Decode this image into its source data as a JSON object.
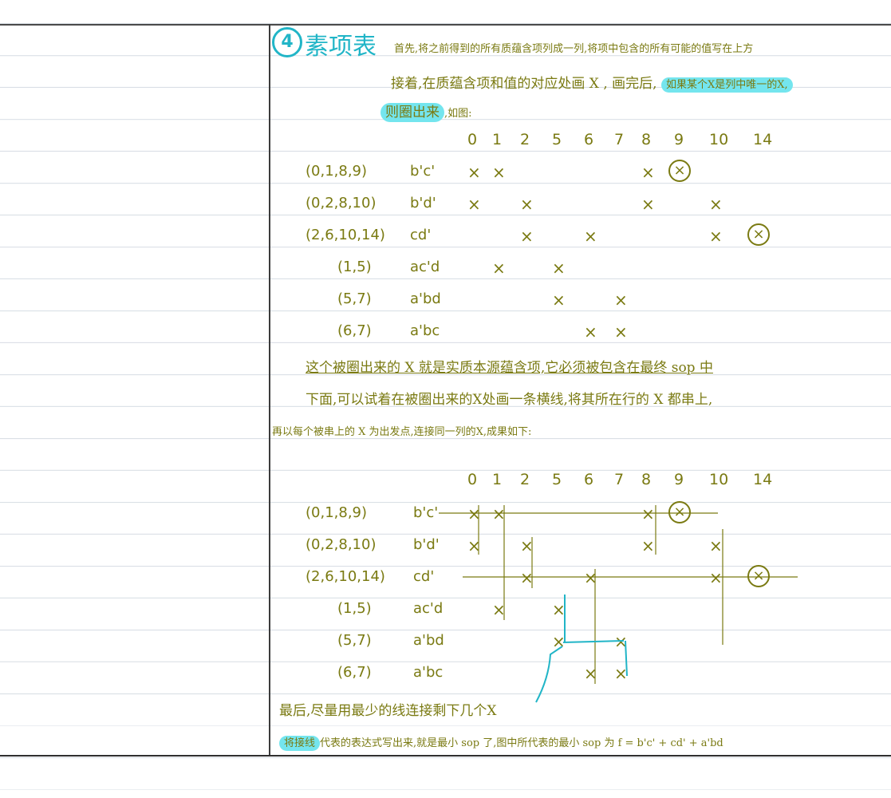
{
  "title": {
    "number": "4",
    "text": "素项表"
  },
  "paragraphs": {
    "p1": "首先,将之前得到的所有质蕴含项列成一列,将项中包含的所有可能的值写在上方",
    "p2_a": "接着,在质蕴含项和值的对应处画 X , 画完后,",
    "p2_b": "如果某个X是列中唯一的X,",
    "p3_hl": "则圈出来",
    "p3_rest": ",如图:",
    "p4": "这个被圈出来的 X 就是实质本源蕴含项,它必须被包含在最终 sop 中",
    "p5": "下面,可以试着在被圈出来的X处画一条横线,将其所在行的 X 都串上,",
    "p6": "再以每个被串上的 X 为出发点,连接同一列的X,成果如下:",
    "p7": "最后,尽量用最少的线连接剩下几个X",
    "p8_hl": "将接线",
    "p8_rest": "代表的表达式写出来,就是最小 sop 了,图中所代表的最小 sop 为 f = b'c' + cd' + a'bd"
  },
  "table1": {
    "columns": [
      "0",
      "1",
      "2",
      "5",
      "6",
      "7",
      "8",
      "9",
      "10",
      "14"
    ],
    "rows": [
      {
        "group": "(0,1,8,9)",
        "term": "b'c'",
        "marks": [
          "0",
          "1",
          "8"
        ],
        "circled": [
          "9"
        ]
      },
      {
        "group": "(0,2,8,10)",
        "term": "b'd'",
        "marks": [
          "0",
          "2",
          "8",
          "10"
        ],
        "circled": []
      },
      {
        "group": "(2,6,10,14)",
        "term": "cd'",
        "marks": [
          "2",
          "6",
          "10"
        ],
        "circled": [
          "14"
        ]
      },
      {
        "group": "(1,5)",
        "term": "ac'd",
        "marks": [
          "1",
          "5"
        ],
        "circled": []
      },
      {
        "group": "(5,7)",
        "term": "a'bd",
        "marks": [
          "5",
          "7"
        ],
        "circled": []
      },
      {
        "group": "(6,7)",
        "term": "a'bc",
        "marks": [
          "6",
          "7"
        ],
        "circled": []
      }
    ]
  },
  "table2": {
    "columns": [
      "0",
      "1",
      "2",
      "5",
      "6",
      "7",
      "8",
      "9",
      "10",
      "14"
    ],
    "rows": [
      {
        "group": "(0,1,8,9)",
        "term": "b'c'"
      },
      {
        "group": "(0,2,8,10)",
        "term": "b'd'"
      },
      {
        "group": "(2,6,10,14)",
        "term": "cd'"
      },
      {
        "group": "(1,5)",
        "term": "ac'd"
      },
      {
        "group": "(5,7)",
        "term": "a'bd"
      },
      {
        "group": "(6,7)",
        "term": "a'bc"
      }
    ]
  },
  "mark_glyph": "×",
  "colors": {
    "ink": "#7a7a12",
    "highlight": "#74e5ee",
    "accent": "#21b5c7"
  }
}
